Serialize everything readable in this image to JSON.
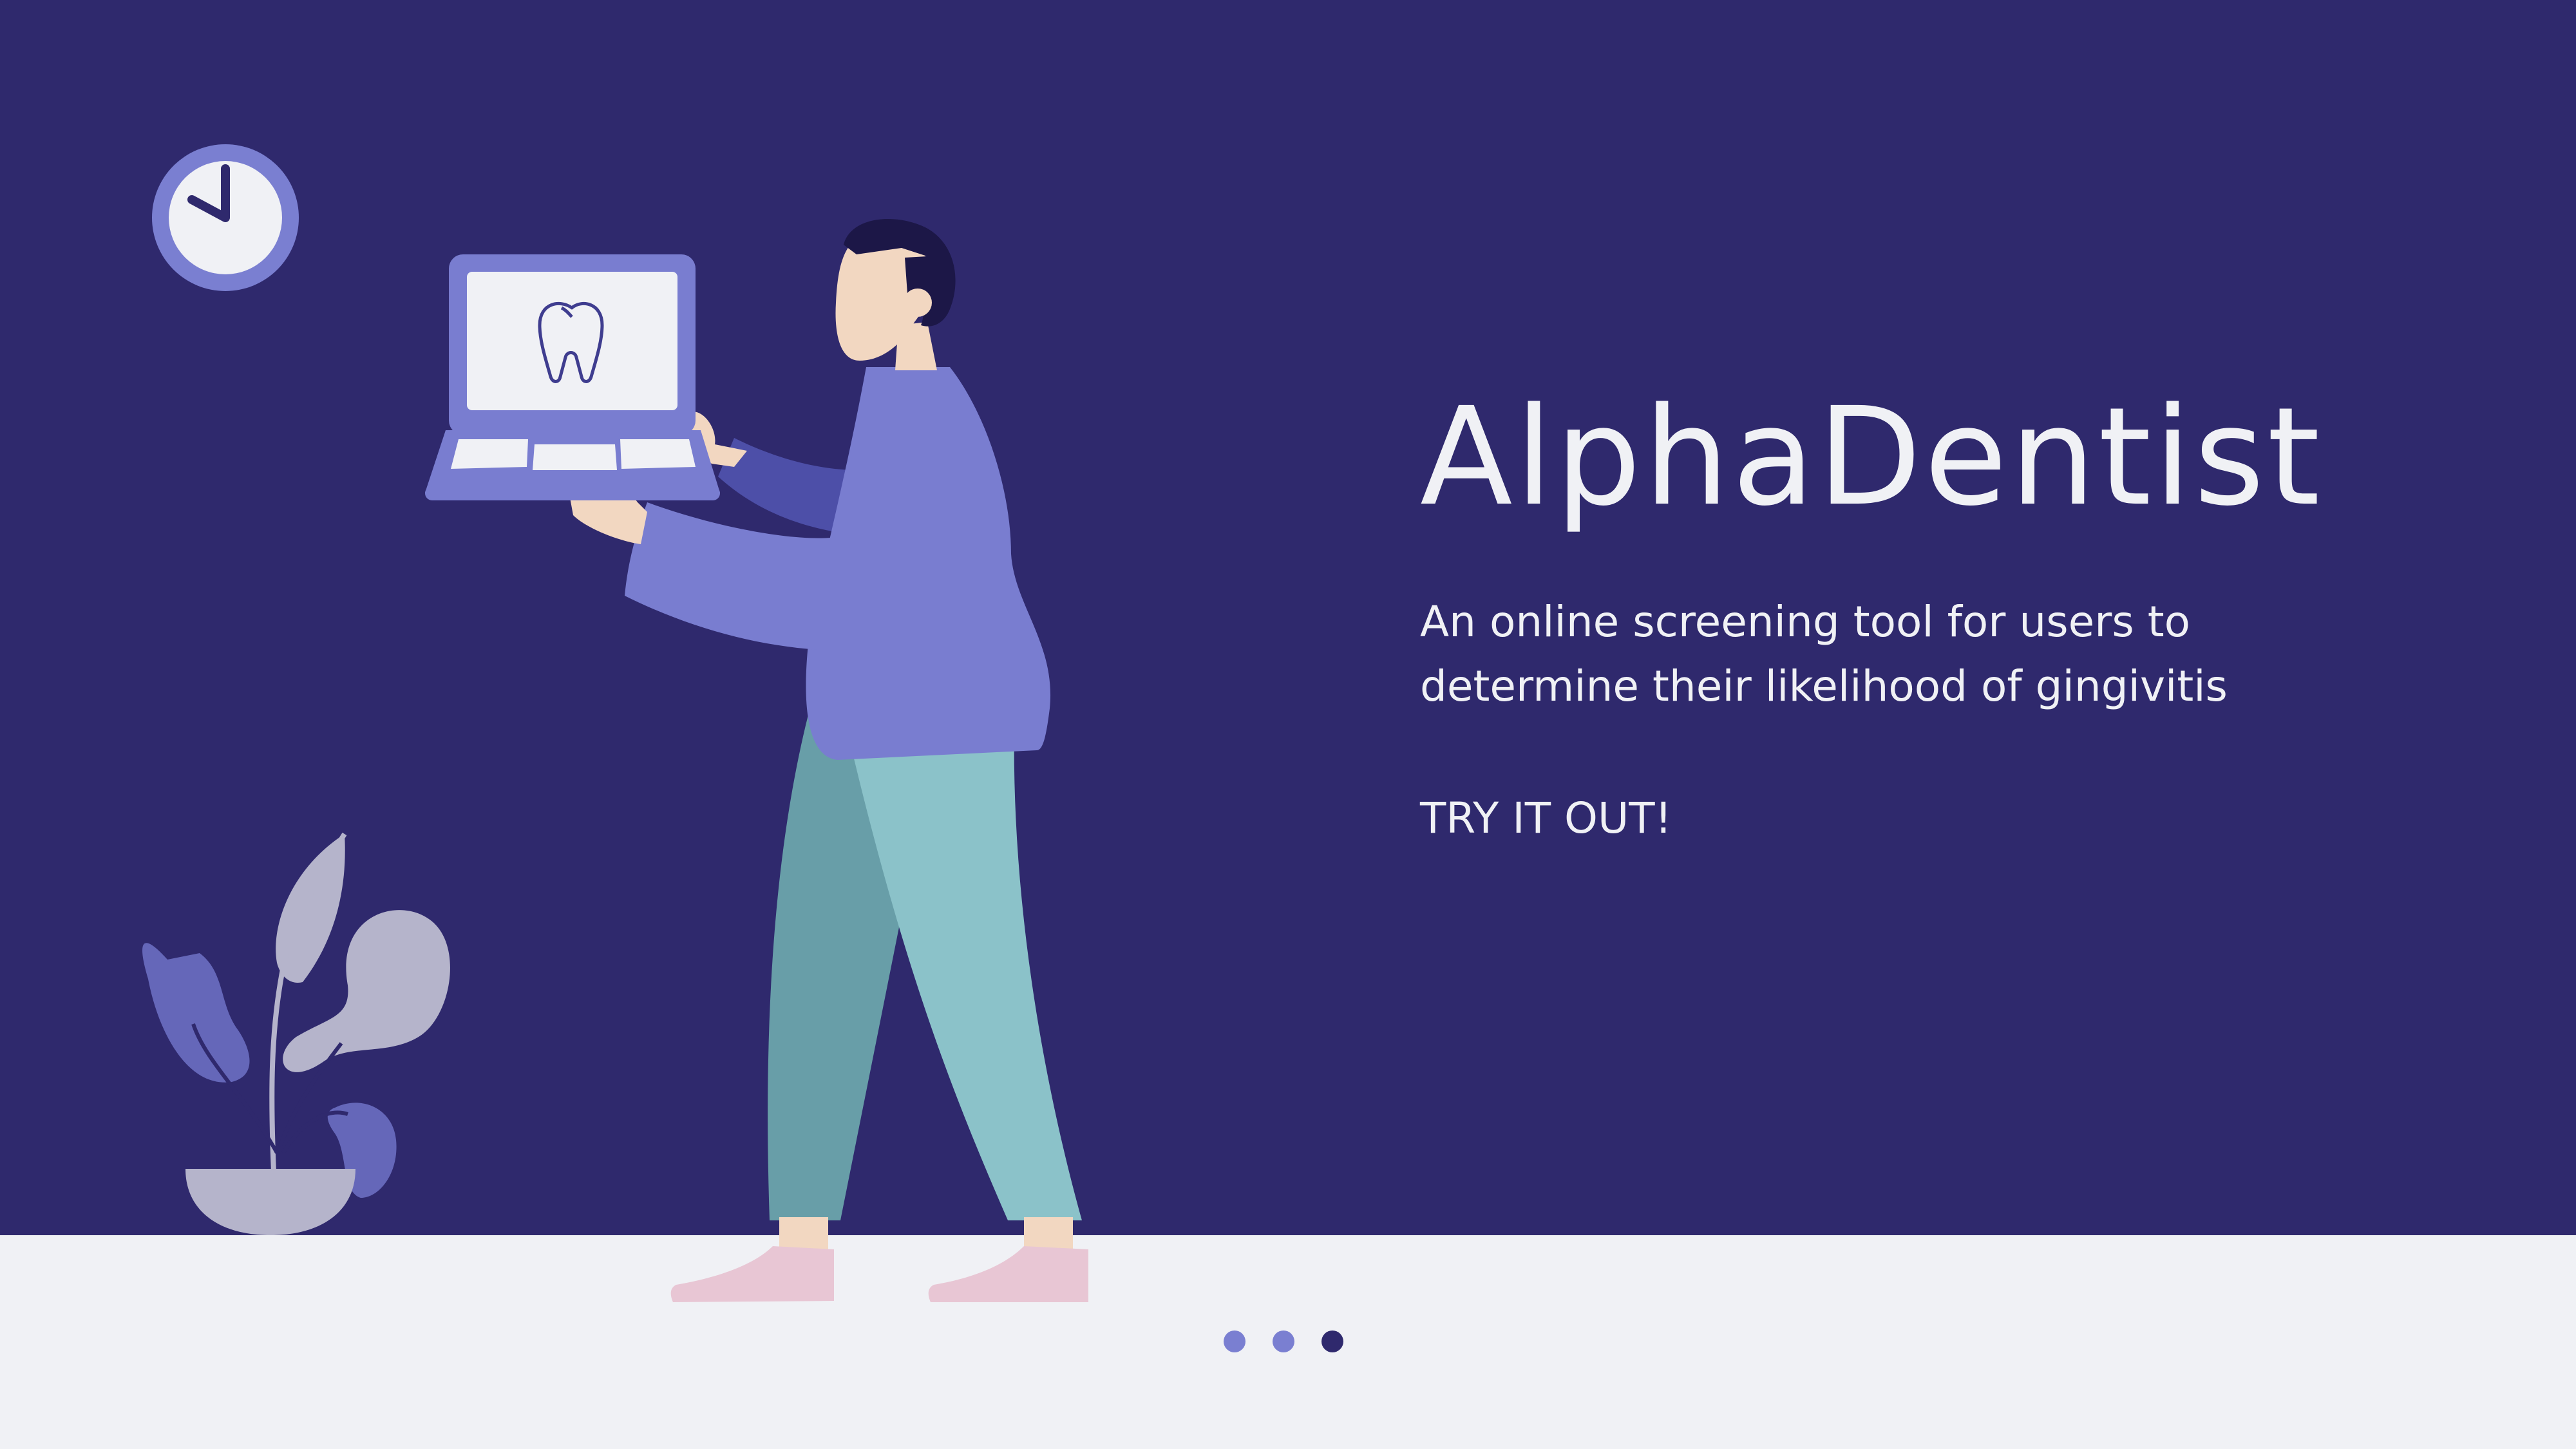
{
  "hero": {
    "title": "AlphaDentist",
    "subtitle": "An online screening tool for users to determine their likelihood of gingivitis",
    "cta": "TRY IT OUT!"
  },
  "carousel": {
    "slide_count": 3,
    "active_index": 3
  },
  "colors": {
    "background": "#2f296d",
    "floor": "#f0f1f5",
    "accent": "#7a7fd1",
    "text": "#f0f1f5"
  },
  "icons": [
    "clock-icon",
    "laptop-icon",
    "tooth-icon",
    "plant-icon"
  ]
}
